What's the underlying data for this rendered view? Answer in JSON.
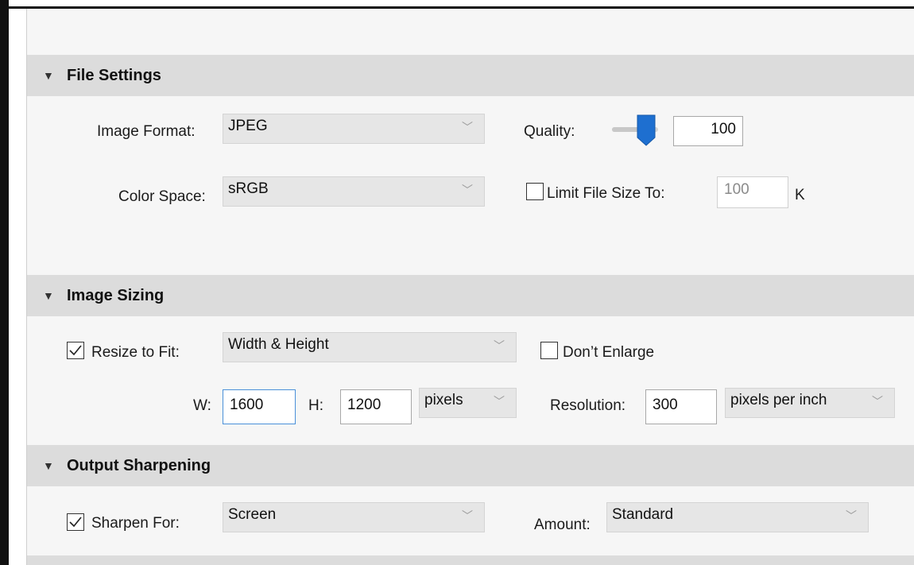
{
  "file_settings": {
    "title": "File Settings",
    "image_format_label": "Image Format:",
    "image_format_value": "JPEG",
    "quality_label": "Quality:",
    "quality_value": "100",
    "quality_level": 1.0,
    "color_space_label": "Color Space:",
    "color_space_value": "sRGB",
    "limit_file_size_label": "Limit File Size To:",
    "limit_file_size_checked": false,
    "limit_file_size_value": "100",
    "limit_file_size_unit": "K"
  },
  "image_sizing": {
    "title": "Image Sizing",
    "resize_to_fit_label": "Resize to Fit:",
    "resize_to_fit_checked": true,
    "resize_mode_value": "Width & Height",
    "dont_enlarge_label": "Don’t Enlarge",
    "dont_enlarge_checked": false,
    "w_label": "W:",
    "w_value": "1600",
    "h_label": "H:",
    "h_value": "1200",
    "unit_value": "pixels",
    "resolution_label": "Resolution:",
    "resolution_value": "300",
    "resolution_unit_value": "pixels per inch"
  },
  "output_sharpening": {
    "title": "Output Sharpening",
    "sharpen_for_label": "Sharpen For:",
    "sharpen_for_checked": true,
    "sharpen_for_value": "Screen",
    "amount_label": "Amount:",
    "amount_value": "Standard"
  },
  "icons": {
    "expand": "triangle-down",
    "dropdown": "chevron-down",
    "check": "checkmark"
  },
  "colors": {
    "section_header_bg": "#dcdcdc",
    "panel_bg": "#f6f6f6",
    "slider_thumb": "#1e6fd0",
    "focus_border": "#4a90d9"
  }
}
